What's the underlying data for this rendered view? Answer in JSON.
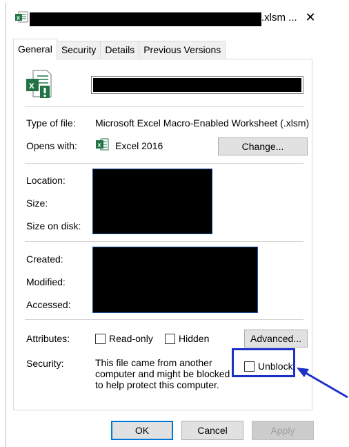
{
  "window": {
    "title_suffix": ".xlsm ...",
    "close_glyph": "✕"
  },
  "tabs": [
    {
      "label": "General",
      "active": true
    },
    {
      "label": "Security",
      "active": false
    },
    {
      "label": "Details",
      "active": false
    },
    {
      "label": "Previous Versions",
      "active": false
    }
  ],
  "general": {
    "type_label": "Type of file:",
    "type_value": "Microsoft Excel Macro-Enabled Worksheet (.xlsm)",
    "opens_label": "Opens with:",
    "opens_value": "Excel 2016",
    "change_button": "Change...",
    "location_label": "Location:",
    "size_label": "Size:",
    "size_on_disk_label": "Size on disk:",
    "created_label": "Created:",
    "modified_label": "Modified:",
    "accessed_label": "Accessed:",
    "attributes_label": "Attributes:",
    "readonly_label": "Read-only",
    "hidden_label": "Hidden",
    "advanced_button": "Advanced...",
    "security_label": "Security:",
    "security_text": "This file came from another computer and might be blocked to help protect this computer.",
    "unblock_label": "Unblock"
  },
  "footer": {
    "ok": "OK",
    "cancel": "Cancel",
    "apply": "Apply"
  },
  "colors": {
    "highlight": "#1c2fc7",
    "excel_green": "#217346",
    "accent": "#0078d7"
  }
}
